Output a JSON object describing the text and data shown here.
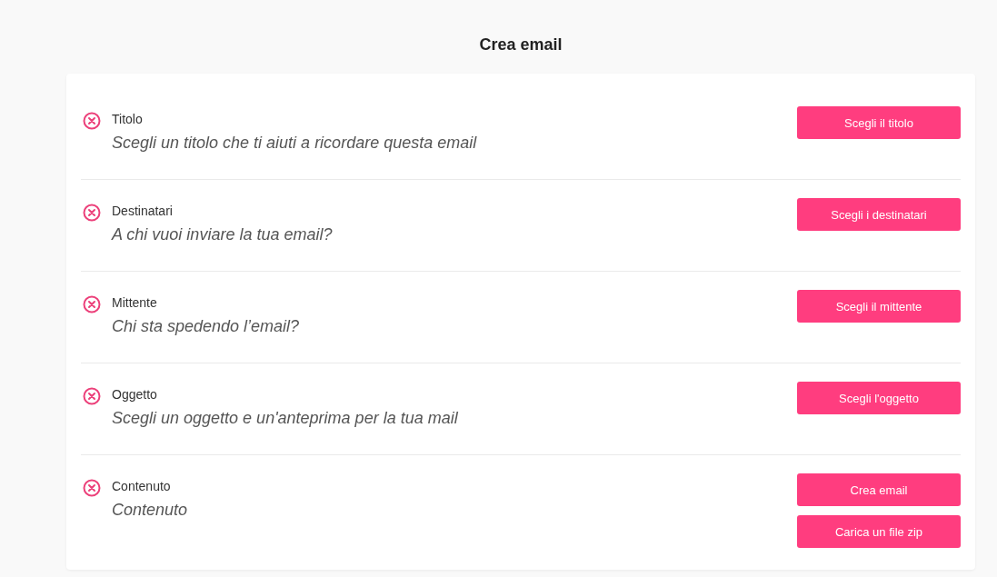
{
  "page_title": "Crea email",
  "sections": [
    {
      "label": "Titolo",
      "description": "Scegli un titolo che ti aiuti a ricordare questa email",
      "complete": false,
      "buttons": [
        "Scegli il titolo"
      ]
    },
    {
      "label": "Destinatari",
      "description": "A chi vuoi inviare la tua email?",
      "complete": false,
      "buttons": [
        "Scegli i destinatari"
      ]
    },
    {
      "label": "Mittente",
      "description": "Chi sta spedendo l’email?",
      "complete": false,
      "buttons": [
        "Scegli il mittente"
      ]
    },
    {
      "label": "Oggetto",
      "description": "Scegli un oggetto e un'anteprima per la tua mail",
      "complete": false,
      "buttons": [
        "Scegli l'oggetto"
      ]
    },
    {
      "label": "Contenuto",
      "description": "Contenuto",
      "complete": false,
      "buttons": [
        "Crea email",
        "Carica un file zip"
      ]
    }
  ]
}
